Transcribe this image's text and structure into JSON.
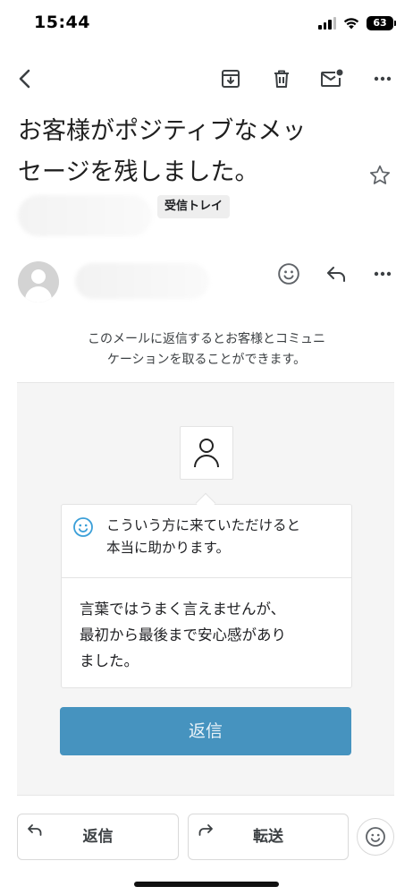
{
  "status_bar": {
    "time": "15:44",
    "battery_level": "63",
    "icons": [
      "signal-icon",
      "wifi-icon",
      "battery-icon"
    ]
  },
  "toolbar": {
    "icons": [
      "back-arrow-icon",
      "archive-icon",
      "trash-icon",
      "mark-unread-icon",
      "more-icon"
    ]
  },
  "email": {
    "subject_line1": "お客様がポジティブなメッ",
    "subject_line2": "セージを残しました。",
    "label_chip": "受信トレイ",
    "notice_line1": "このメールに返信するとお客様とコミュニ",
    "notice_line2": "ケーションを取ることができます。"
  },
  "card": {
    "title_line1": "こういう方に来ていただけると",
    "title_line2": "本当に助かります。",
    "body_line1": "言葉ではうまく言えませんが、",
    "body_line2": "最初から最後まで安心感があり",
    "body_line3": "ました。",
    "reply_button": "返信"
  },
  "bottom_bar": {
    "reply_label": "返信",
    "forward_label": "転送"
  },
  "colors": {
    "accent_blue": "#4693bf",
    "smile_blue": "#3b9fd8",
    "card_background": "#f5f5f5"
  }
}
